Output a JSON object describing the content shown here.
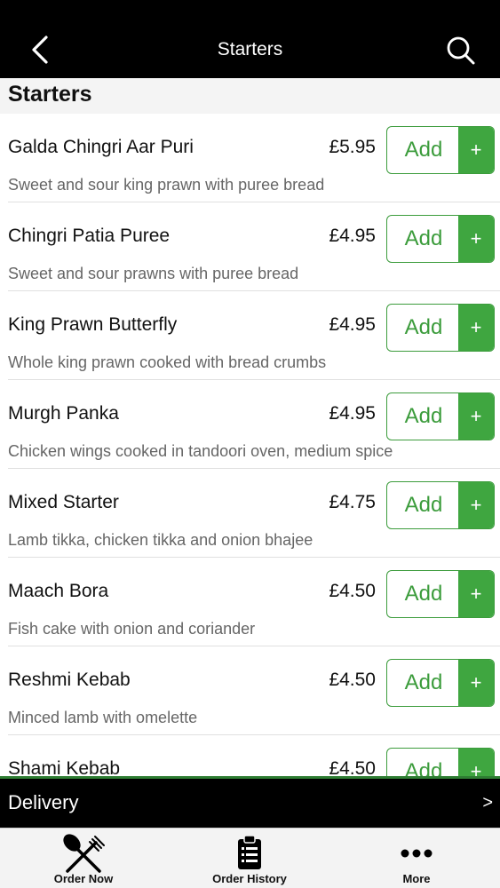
{
  "header": {
    "title": "Starters",
    "back_icon": "chevron-left-icon",
    "search_icon": "search-icon"
  },
  "section": {
    "title": "Starters"
  },
  "items": [
    {
      "name": "Galda Chingri Aar Puri",
      "price": "£5.95",
      "desc": "Sweet and sour king prawn with puree bread",
      "add_label": "Add",
      "plus_label": "+"
    },
    {
      "name": "Chingri Patia Puree",
      "price": "£4.95",
      "desc": "Sweet and sour prawns with puree bread",
      "add_label": "Add",
      "plus_label": "+"
    },
    {
      "name": "King Prawn Butterfly",
      "price": "£4.95",
      "desc": "Whole king prawn cooked with bread crumbs",
      "add_label": "Add",
      "plus_label": "+"
    },
    {
      "name": "Murgh Panka",
      "price": "£4.95",
      "desc": "Chicken wings cooked in tandoori oven, medium spice",
      "add_label": "Add",
      "plus_label": "+"
    },
    {
      "name": "Mixed Starter",
      "price": "£4.75",
      "desc": "Lamb tikka, chicken tikka and onion bhajee",
      "add_label": "Add",
      "plus_label": "+"
    },
    {
      "name": "Maach Bora",
      "price": "£4.50",
      "desc": "Fish cake with onion and coriander",
      "add_label": "Add",
      "plus_label": "+"
    },
    {
      "name": "Reshmi Kebab",
      "price": "£4.50",
      "desc": "Minced lamb with omelette",
      "add_label": "Add",
      "plus_label": "+"
    },
    {
      "name": "Shami Kebab",
      "price": "£4.50",
      "desc": "",
      "add_label": "Add",
      "plus_label": "+"
    }
  ],
  "delivery": {
    "label": "Delivery",
    "arrow": ">"
  },
  "tabs": [
    {
      "label": "Order Now",
      "icon": "fork-knife-icon"
    },
    {
      "label": "Order History",
      "icon": "clipboard-icon"
    },
    {
      "label": "More",
      "icon": "more-dots-icon"
    }
  ],
  "colors": {
    "accent": "#3fa640",
    "bar": "#000000"
  }
}
